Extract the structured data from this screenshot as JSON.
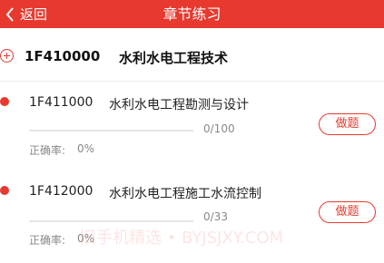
{
  "header": {
    "back_label": "返回",
    "title": "章节练习"
  },
  "group": {
    "code": "1F410000",
    "name": "水利水电工程技术"
  },
  "chapters": [
    {
      "code": "1F411000",
      "name": "水利水电工程勘测与设计",
      "progress_text": "0/100",
      "progress_fraction": 0,
      "accuracy_label": "正确率:",
      "accuracy_value": "0%",
      "button_label": "做题"
    },
    {
      "code": "1F412000",
      "name": "水利水电工程施工水流控制",
      "progress_text": "0/33",
      "progress_fraction": 0,
      "accuracy_label": "正确率:",
      "accuracy_value": "0%",
      "button_label": "做题"
    }
  ],
  "watermark": "旧手机精选 • BYJSJXY.COM",
  "colors": {
    "accent": "#e8392f",
    "header_bg": "#e8392f"
  },
  "icons": {
    "back": "chevron-left-icon",
    "group_toggle": "circle-plus-icon",
    "chapter_marker": "red-dot-icon"
  }
}
